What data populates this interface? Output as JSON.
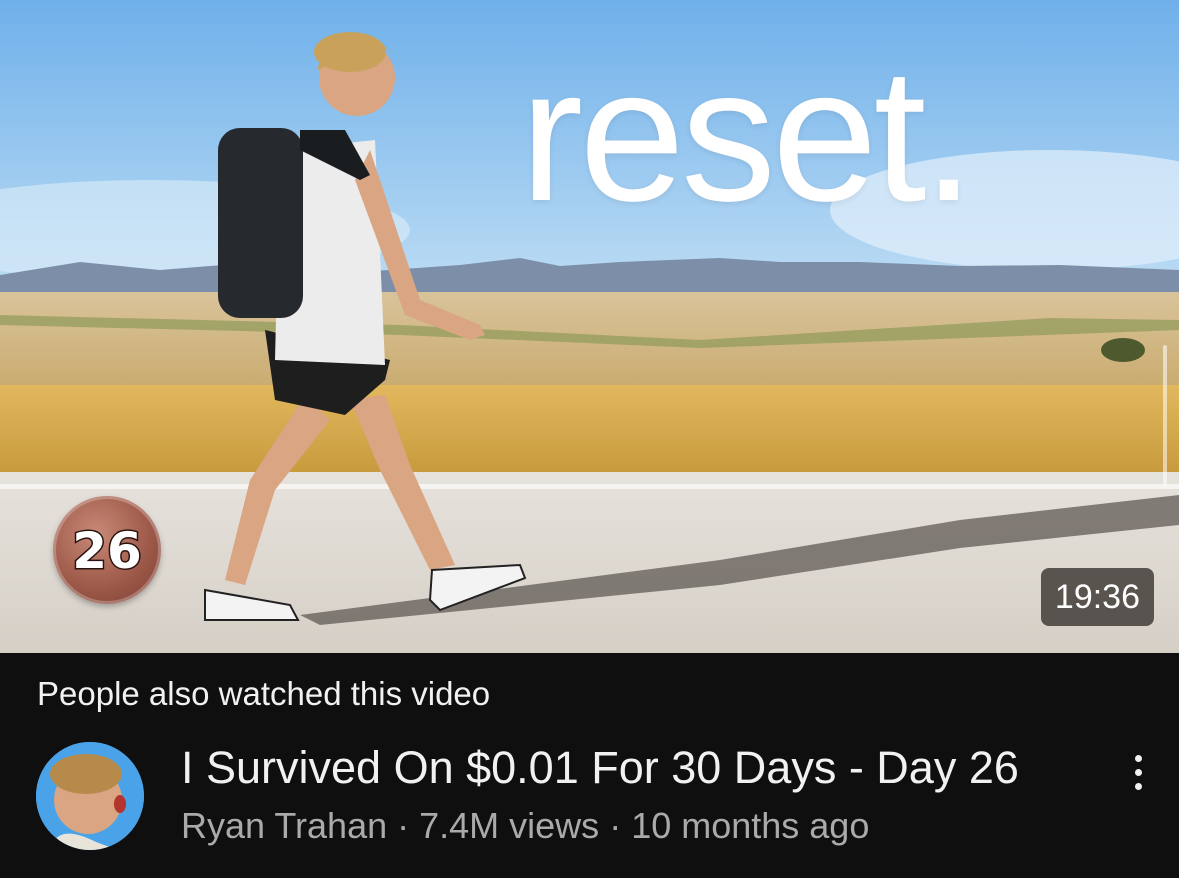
{
  "thumbnail": {
    "overlay_text": "reset.",
    "day_badge": "26",
    "duration": "19:36"
  },
  "section_label": "People also watched this video",
  "video": {
    "title": "I Survived On $0.01 For 30 Days - Day 26",
    "channel": "Ryan Trahan",
    "views": "7.4M views",
    "age": "10 months ago"
  },
  "icons": {
    "more": "more-vert-icon"
  },
  "colors": {
    "background": "#0f0f0f",
    "title_text": "#f1f1f1",
    "meta_text": "#aaaaaa",
    "sky": "#8ec2ee"
  }
}
